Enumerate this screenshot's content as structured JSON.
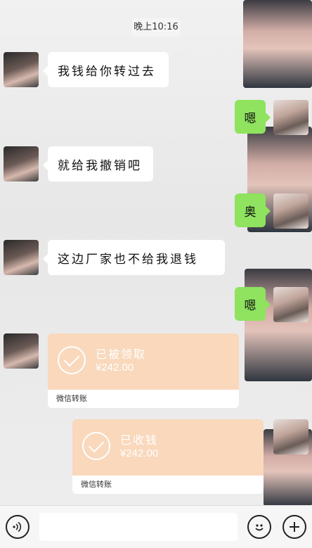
{
  "chat": {
    "time": "晚上10:16",
    "messages": [
      {
        "side": "left",
        "text": "我钱给你转过去"
      },
      {
        "side": "right",
        "text": "嗯"
      },
      {
        "side": "left",
        "text": "就给我撤销吧"
      },
      {
        "side": "right",
        "text": "奥"
      },
      {
        "side": "left",
        "text": "这边厂家也不给我退钱"
      },
      {
        "side": "right",
        "text": "嗯"
      }
    ],
    "transfers": [
      {
        "side": "left",
        "status": "已被领取",
        "amount": "¥242.00",
        "label": "微信转账"
      },
      {
        "side": "right",
        "status": "已收钱",
        "amount": "¥242.00",
        "label": "微信转账"
      }
    ]
  },
  "input_bar": {
    "voice_icon": "voice-icon",
    "emoji_icon": "emoji-icon",
    "plus_icon": "plus-icon"
  },
  "colors": {
    "green_bubble": "#8fe35f",
    "transfer_top": "#f9d8bc"
  }
}
